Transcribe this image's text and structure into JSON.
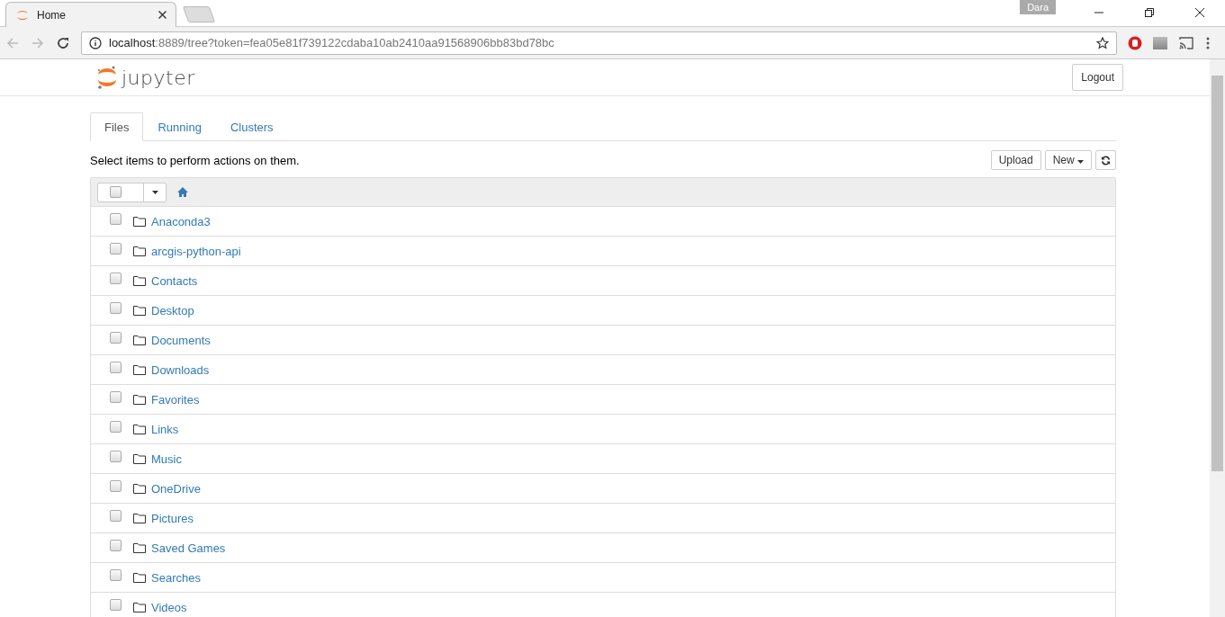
{
  "browser": {
    "tab_title": "Home",
    "profile": "Dara",
    "url_host": "localhost",
    "url_rest": ":8889/tree?token=fea05e81f739122cdaba10ab2410aa91568906bb83bd78bc"
  },
  "header": {
    "wordmark": "jupyter",
    "logout": "Logout"
  },
  "tabs": [
    {
      "label": "Files",
      "selected": true
    },
    {
      "label": "Running",
      "selected": false
    },
    {
      "label": "Clusters",
      "selected": false
    }
  ],
  "instructions": "Select items to perform actions on them.",
  "toolbar": {
    "upload": "Upload",
    "new": "New"
  },
  "select_all": {
    "checked": false
  },
  "files": [
    {
      "name": "Anaconda3",
      "checked": false
    },
    {
      "name": "arcgis-python-api",
      "checked": false
    },
    {
      "name": "Contacts",
      "checked": false
    },
    {
      "name": "Desktop",
      "checked": false
    },
    {
      "name": "Documents",
      "checked": false
    },
    {
      "name": "Downloads",
      "checked": false
    },
    {
      "name": "Favorites",
      "checked": false
    },
    {
      "name": "Links",
      "checked": false
    },
    {
      "name": "Music",
      "checked": false
    },
    {
      "name": "OneDrive",
      "checked": false
    },
    {
      "name": "Pictures",
      "checked": false
    },
    {
      "name": "Saved Games",
      "checked": false
    },
    {
      "name": "Searches",
      "checked": false
    },
    {
      "name": "Videos",
      "checked": false
    }
  ]
}
